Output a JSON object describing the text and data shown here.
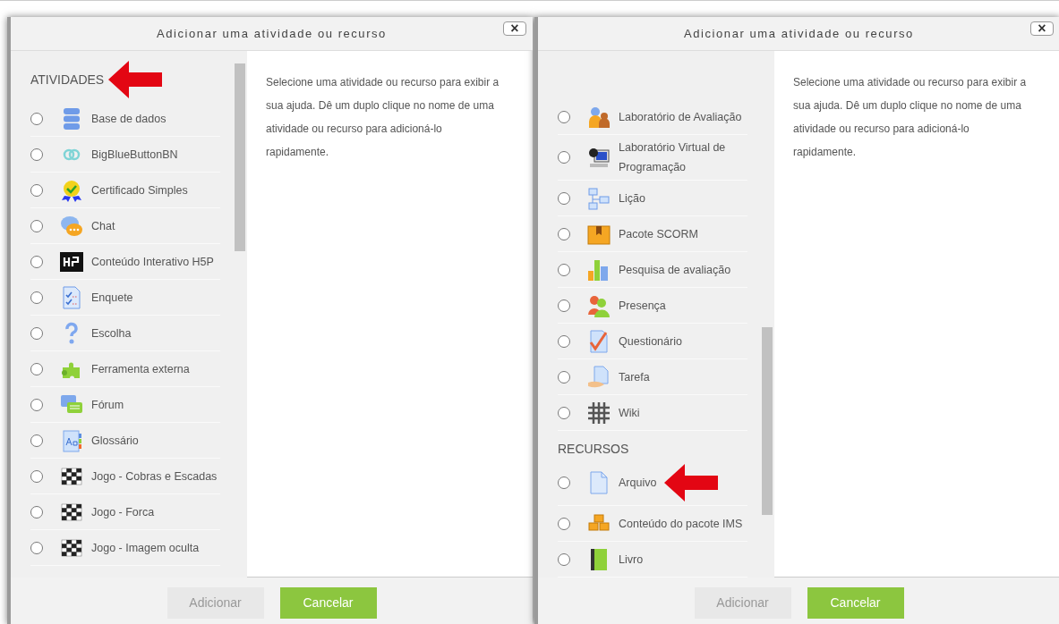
{
  "dialogs": [
    {
      "title": "Adicionar uma atividade ou recurso",
      "close": "×",
      "sections": [
        {
          "heading": "ATIVIDADES",
          "annotated": true,
          "items": [
            {
              "label": "Base de dados",
              "kind": "database",
              "selected": false,
              "annotated": false
            },
            {
              "label": "BigBlueButtonBN",
              "kind": "link",
              "selected": false,
              "annotated": false
            },
            {
              "label": "Certificado Simples",
              "kind": "award",
              "selected": false,
              "annotated": false
            },
            {
              "label": "Chat",
              "kind": "chat",
              "selected": false,
              "annotated": false
            },
            {
              "label": "Conteúdo Interativo H5P",
              "kind": "h5p",
              "selected": false,
              "annotated": false
            },
            {
              "label": "Enquete",
              "kind": "survey",
              "selected": false,
              "annotated": false
            },
            {
              "label": "Escolha",
              "kind": "question",
              "selected": false,
              "annotated": false
            },
            {
              "label": "Ferramenta externa",
              "kind": "puzzle",
              "selected": false,
              "annotated": false
            },
            {
              "label": "Fórum",
              "kind": "forum",
              "selected": false,
              "annotated": false
            },
            {
              "label": "Glossário",
              "kind": "glossary",
              "selected": false,
              "annotated": false
            },
            {
              "label": "Jogo - Cobras e Escadas",
              "kind": "game",
              "selected": false,
              "annotated": false
            },
            {
              "label": "Jogo - Forca",
              "kind": "game",
              "selected": false,
              "annotated": false
            },
            {
              "label": "Jogo - Imagem oculta",
              "kind": "game",
              "selected": false,
              "annotated": false
            }
          ]
        }
      ],
      "help": "Selecione uma atividade ou recurso para exibir a sua ajuda. Dê um duplo clique no nome de uma atividade ou recurso para adicioná-lo rapidamente.",
      "buttons": [
        {
          "label": "Adicionar",
          "kind": "disabled"
        },
        {
          "label": "Cancelar",
          "kind": "primary"
        }
      ]
    },
    {
      "title": "Adicionar uma atividade ou recurso",
      "close": "×",
      "sections": [
        {
          "items": [
            {
              "label": "Laboratório de Avaliação",
              "kind": "lab",
              "selected": false,
              "annotated": false
            },
            {
              "label": "Laboratório Virtual de Programação",
              "kind": "computer",
              "selected": false,
              "annotated": false
            },
            {
              "label": "Lição",
              "kind": "lesson",
              "selected": false,
              "annotated": false
            },
            {
              "label": "Pacote SCORM",
              "kind": "package",
              "selected": false,
              "annotated": false
            },
            {
              "label": "Pesquisa de avaliação",
              "kind": "chart",
              "selected": false,
              "annotated": false
            },
            {
              "label": "Presença",
              "kind": "people",
              "selected": false,
              "annotated": false
            },
            {
              "label": "Questionário",
              "kind": "quiz",
              "selected": false,
              "annotated": false
            },
            {
              "label": "Tarefa",
              "kind": "assignment",
              "selected": false,
              "annotated": false
            },
            {
              "label": "Wiki",
              "kind": "wiki",
              "selected": false,
              "annotated": false
            }
          ]
        },
        {
          "heading": "RECURSOS",
          "items": [
            {
              "label": "Arquivo",
              "kind": "file",
              "selected": false,
              "annotated": true
            },
            {
              "label": "Conteúdo do pacote IMS",
              "kind": "boxes",
              "selected": false,
              "annotated": false
            },
            {
              "label": "Livro",
              "kind": "book",
              "selected": false,
              "annotated": false
            }
          ]
        }
      ],
      "help": "Selecione uma atividade ou recurso para exibir a sua ajuda. Dê um duplo clique no nome de uma atividade ou recurso para adicioná-lo rapidamente.",
      "buttons": [
        {
          "label": "Adicionar",
          "kind": "disabled"
        },
        {
          "label": "Cancelar",
          "kind": "primary"
        }
      ]
    }
  ]
}
